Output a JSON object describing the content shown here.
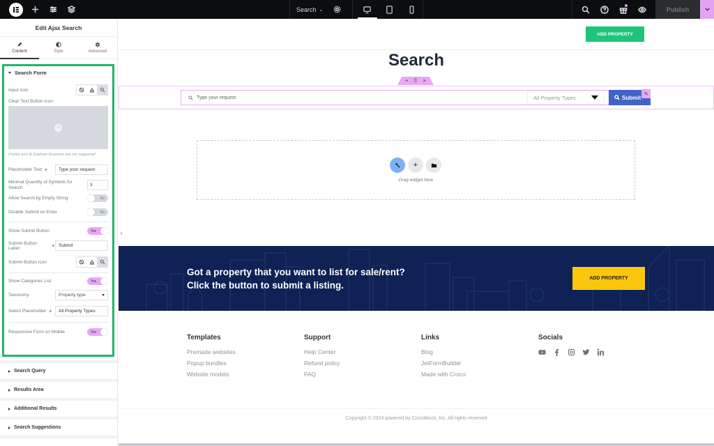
{
  "topbar": {
    "document_name": "Search",
    "publish_label": "Publish",
    "icons": [
      "elementor-logo-icon",
      "add-element-icon",
      "site-settings-icon",
      "structure-icon",
      "page-settings-icon",
      "desktop-icon",
      "tablet-icon",
      "mobile-icon",
      "finder-search-icon",
      "help-icon",
      "whats-new-gift-icon",
      "preview-eye-icon",
      "publish-options-chevron-icon"
    ],
    "active_device": "desktop"
  },
  "panel": {
    "title": "Edit Ajax Search",
    "tabs": [
      {
        "label": "Content",
        "icon": "pencil-icon",
        "active": true
      },
      {
        "label": "Style",
        "icon": "half-circle-icon",
        "active": false
      },
      {
        "label": "Advanced",
        "icon": "gear-icon",
        "active": false
      }
    ],
    "search_form": {
      "heading": "Search Form",
      "input_icon_label": "Input Icon",
      "clear_icon_label": "Clear Text Button Icon",
      "clear_icon_note": "Firefox and IE Explorer browsers are not supported",
      "placeholder_label": "Placeholder Text",
      "placeholder_value": "Type your request",
      "min_symbols_label": "Minimal Quantity of Symbols for Search",
      "min_symbols_value": "3",
      "allow_empty_label": "Allow Search by Empty String",
      "allow_empty_value": "No",
      "disable_submit_label": "Disable Submit on Enter",
      "disable_submit_value": "No",
      "show_submit_label": "Show Submit Button",
      "show_submit_value": "Yes",
      "submit_label_label": "Submit Button Label",
      "submit_label_value": "Submit",
      "submit_icon_label": "Submit Button Icon",
      "show_categories_label": "Show Categories List",
      "show_categories_value": "Yes",
      "taxonomy_label": "Taxonomy",
      "taxonomy_value": "Property type",
      "select_placeholder_label": "Select Placeholder",
      "select_placeholder_value": "All Property Types",
      "responsive_label": "Responsive Form on Mobile",
      "responsive_value": "Yes"
    },
    "collapsed_sections": [
      "Search Query",
      "Results Area",
      "Additional Results",
      "Search Suggestions"
    ]
  },
  "canvas": {
    "add_property_top": "ADD PROPERTY",
    "page_title": "Search",
    "search_placeholder": "Type your request",
    "category_placeholder": "All Property Types",
    "submit_label": "Submit",
    "drop_zone_label": "Drag widget here",
    "banner_line1": "Got a property that you want to list for sale/rent?",
    "banner_line2": "Click the button to submit a listing.",
    "banner_button": "ADD PROPERTY",
    "footer": [
      {
        "title": "Templates",
        "links": [
          "Premade websites",
          "Popup bundles",
          "Website models"
        ]
      },
      {
        "title": "Support",
        "links": [
          "Help Center",
          "Refund policy",
          "FAQ"
        ]
      },
      {
        "title": "Links",
        "links": [
          "Blog",
          "JetFormBuilder",
          "Made with Croco"
        ]
      },
      {
        "title": "Socials",
        "links": []
      }
    ],
    "socials": [
      "youtube-icon",
      "facebook-icon",
      "instagram-icon",
      "twitter-icon",
      "linkedin-icon"
    ],
    "copyright": "Copyright © 2024 powered by Crocoblock, Inc. All rights reserved"
  },
  "colors": {
    "section_highlight": "#20b56a",
    "green_button": "#1dc57a",
    "submit_blue": "#3f63c8",
    "banner_navy": "#0f2155",
    "yellow_button": "#fbc70e",
    "editor_pink": "#e9a7f5"
  }
}
